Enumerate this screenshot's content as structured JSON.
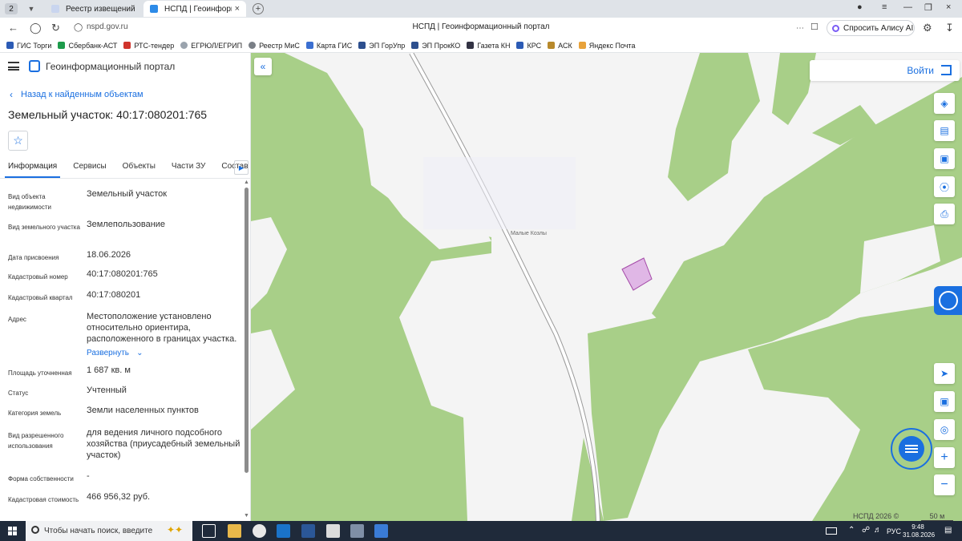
{
  "browser": {
    "tab_count": "2",
    "tabs": [
      {
        "title": "Реестр извещений"
      },
      {
        "title": "НСПД | Геоинформацио"
      }
    ],
    "url": "nspd.gov.ru",
    "page_title": "НСПД | Геоинформационный портал",
    "alice_label": "Спросить Алису AI",
    "bookmarks": [
      "ГИС Торги",
      "Сбербанк-АСТ",
      "РТС-тендер",
      "ЕГРЮЛ/ЕГРИП",
      "Реестр МиС",
      "Карта ГИС",
      "ЭП ГорУпр",
      "ЭП ПрокКО",
      "Газета КН",
      "КРС",
      "АСК",
      "Яндекс Почта"
    ]
  },
  "panel": {
    "portal_title": "Геоинформационный портал",
    "back_label": "Назад к найденным объектам",
    "object_title": "Земельный участок: 40:17:080201:765",
    "tabs": [
      "Информация",
      "Сервисы",
      "Объекты",
      "Части ЗУ",
      "Состав"
    ],
    "properties": [
      {
        "label": "Вид объекта недвижимости",
        "value": "Земельный участок"
      },
      {
        "label": "Вид земельного участка",
        "value": "Землепользование"
      },
      {
        "label": "Дата присвоения",
        "value": "18.06.2026"
      },
      {
        "label": "Кадастровый номер",
        "value": "40:17:080201:765"
      },
      {
        "label": "Кадастровый квартал",
        "value": "40:17:080201"
      },
      {
        "label": "Адрес",
        "value": "Местоположение установлено относительно ориентира, расположенного в границах участка."
      },
      {
        "label": "Площадь уточненная",
        "value": "1 687 кв. м"
      },
      {
        "label": "Статус",
        "value": "Учтенный"
      },
      {
        "label": "Категория земель",
        "value": "Земли населенных пунктов"
      },
      {
        "label": "Вид разрешенного использования",
        "value": "для ведения личного подсобного хозяйства (приусадебный земельный участок)"
      },
      {
        "label": "Форма собственности",
        "value": "-"
      },
      {
        "label": "Кадастровая стоимость",
        "value": "466 956,32 руб."
      }
    ],
    "expand_label": "Развернуть"
  },
  "map": {
    "login_label": "Войти",
    "place_name": "Малые Козлы",
    "copyright": "НСПД 2026 ©",
    "scale_label": "50 м",
    "colors": {
      "forest": "#a8cf88",
      "parcel_fill": "#e0b7e6",
      "parcel_stroke": "#a44aa8",
      "accent": "#1a6fe0"
    }
  },
  "taskbar": {
    "search_placeholder": "Чтобы начать поиск, введите",
    "language": "РУС",
    "time": "9:48",
    "date": "31.08.2026"
  }
}
